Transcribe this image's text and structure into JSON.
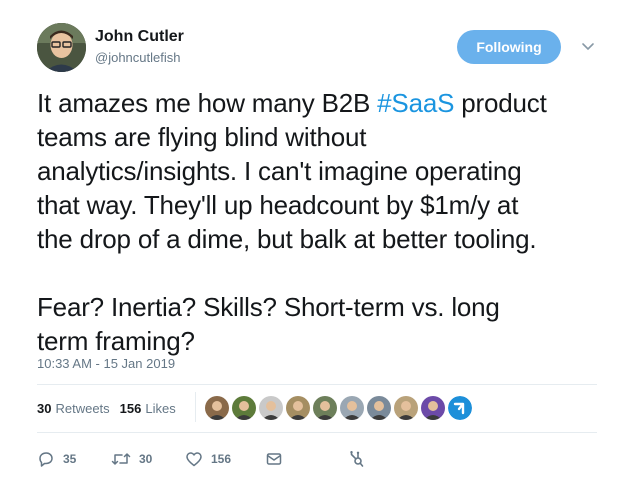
{
  "author": {
    "name": "John Cutler",
    "handle": "@johncutlefish"
  },
  "follow_button": {
    "label": "Following",
    "color": "#6ab1ec"
  },
  "tweet": {
    "line1_pre": "It amazes me how many B2B ",
    "hashtag": "#SaaS",
    "line1_post": " product",
    "rest": "teams are flying blind without\nanalytics/insights. I can't imagine operating\nthat way.  They'll up headcount by $1m/y at\nthe drop of a dime, but balk at better tooling.\n\nFear? Inertia? Skills? Short-term vs. long\nterm framing?",
    "hashtag_color": "#1b95e0"
  },
  "timestamp": "10:33 AM - 15 Jan 2019",
  "stats": {
    "retweets_count": "30",
    "retweets_label": "Retweets",
    "likes_count": "156",
    "likes_label": "Likes"
  },
  "likers": [
    {
      "icon": "avatar",
      "color": "#8a6a4a"
    },
    {
      "icon": "avatar",
      "color": "#5d7b3a"
    },
    {
      "icon": "avatar",
      "color": "#c9c9c9"
    },
    {
      "icon": "avatar",
      "color": "#a58e62"
    },
    {
      "icon": "avatar",
      "color": "#6d7f5a"
    },
    {
      "icon": "avatar",
      "color": "#9aa7b3"
    },
    {
      "icon": "avatar",
      "color": "#7a8a9a"
    },
    {
      "icon": "avatar",
      "color": "#b9a27a"
    },
    {
      "icon": "avatar",
      "color": "#6c4aa8"
    },
    {
      "icon": "logo",
      "color": "#1d8fd9"
    }
  ],
  "actions": {
    "reply_count": "35",
    "retweet_count": "30",
    "like_count": "156"
  }
}
